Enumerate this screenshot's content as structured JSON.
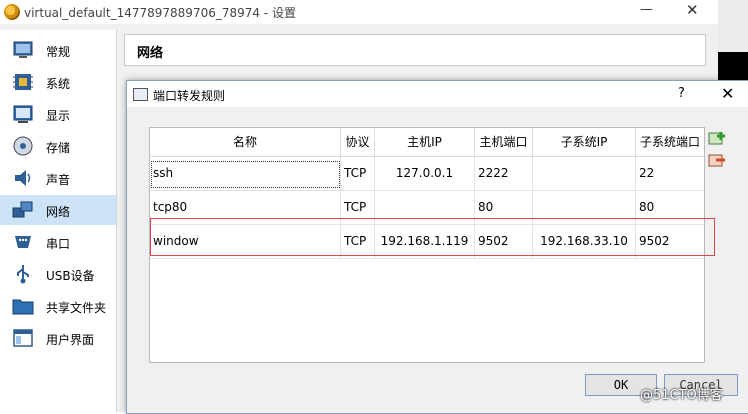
{
  "window": {
    "title": "virtual_default_1477897889706_78974 - 设置",
    "minimize_glyph": "—",
    "close_glyph": "✕"
  },
  "sidebar": {
    "items": [
      {
        "label": "常规",
        "icon": "general-icon"
      },
      {
        "label": "系统",
        "icon": "system-icon"
      },
      {
        "label": "显示",
        "icon": "display-icon"
      },
      {
        "label": "存储",
        "icon": "storage-icon"
      },
      {
        "label": "声音",
        "icon": "audio-icon"
      },
      {
        "label": "网络",
        "icon": "network-icon",
        "active": true
      },
      {
        "label": "串口",
        "icon": "serial-port-icon"
      },
      {
        "label": "USB设备",
        "icon": "usb-icon"
      },
      {
        "label": "共享文件夹",
        "icon": "shared-folder-icon"
      },
      {
        "label": "用户界面",
        "icon": "user-interface-icon"
      }
    ]
  },
  "pane": {
    "title": "网络"
  },
  "dialog": {
    "title": "端口转发规则",
    "help_glyph": "?",
    "close_glyph": "✕",
    "table": {
      "columns": [
        "名称",
        "协议",
        "主机IP",
        "主机端口",
        "子系统IP",
        "子系统端口"
      ],
      "rows": [
        {
          "name": "ssh",
          "protocol": "TCP",
          "host_ip": "127.0.0.1",
          "host_port": "2222",
          "guest_ip": "",
          "guest_port": "22"
        },
        {
          "name": "tcp80",
          "protocol": "TCP",
          "host_ip": "",
          "host_port": "80",
          "guest_ip": "",
          "guest_port": "80"
        },
        {
          "name": "window",
          "protocol": "TCP",
          "host_ip": "192.168.1.119",
          "host_port": "9502",
          "guest_ip": "192.168.33.10",
          "guest_port": "9502"
        }
      ]
    },
    "buttons": {
      "ok": "OK",
      "cancel": "Cancel"
    },
    "side_buttons": [
      "add-rule-icon",
      "remove-rule-icon"
    ]
  },
  "watermark": "@51CTO博客",
  "colors": {
    "highlight": "#e0454c",
    "sidebar_active": "#cde3f7",
    "accent": "#7a9cc9"
  }
}
